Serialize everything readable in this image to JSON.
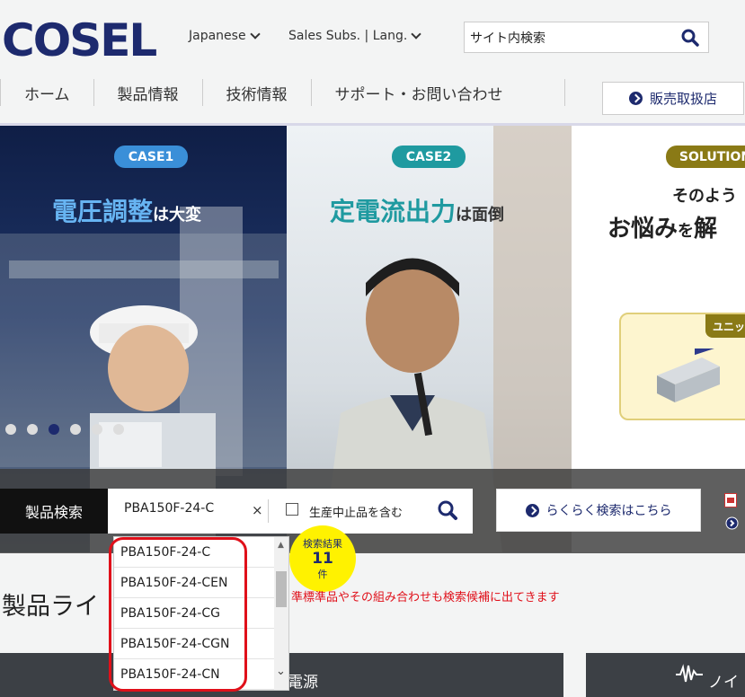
{
  "header": {
    "logo_text": "COSEL",
    "lang_link": "Japanese",
    "subs_link": "Sales Subs. | Lang.",
    "search_value": "サイト内検索"
  },
  "nav": {
    "items": [
      "ホーム",
      "製品情報",
      "技術情報",
      "サポート・お問い合わせ"
    ],
    "dealer_button": "販売取扱店"
  },
  "banner": {
    "panels": [
      {
        "tag": "CASE1",
        "headline_main": "電圧調整",
        "headline_sub": "は大変"
      },
      {
        "tag": "CASE2",
        "headline_main": "定電流出力",
        "headline_sub": "は面倒"
      },
      {
        "tag": "SOLUTION",
        "line1": "そのよう",
        "line2_main": "お悩み",
        "line2_sub": "を",
        "line2_end": "解",
        "product_tag": "ユニッ"
      }
    ],
    "dots": 6,
    "active_dot": 3
  },
  "product_search": {
    "label": "製品検索",
    "query": "PBA150F-24-C",
    "clear": "×",
    "discontinued_label": "生産中止品を含む",
    "easy_search_button": "らくらく検索はこちら"
  },
  "result_badge": {
    "label": "検索結果",
    "count": "11",
    "unit": "件"
  },
  "suggestions": [
    "PBA150F-24-C",
    "PBA150F-24-CEN",
    "PBA150F-24-CG",
    "PBA150F-24-CGN",
    "PBA150F-24-CN"
  ],
  "annotation": "準標準品やその組み合わせも検索候補に出てきます",
  "lineup": {
    "title": "製品ライ",
    "card_left": "電源",
    "card_right": "ノイ"
  },
  "colors": {
    "navy": "#1d2a6e",
    "case1": "#3a8fd8",
    "case2": "#1f9aa0",
    "solution": "#8a7a16",
    "badge": "#fff200",
    "annotation": "#e0101a"
  }
}
